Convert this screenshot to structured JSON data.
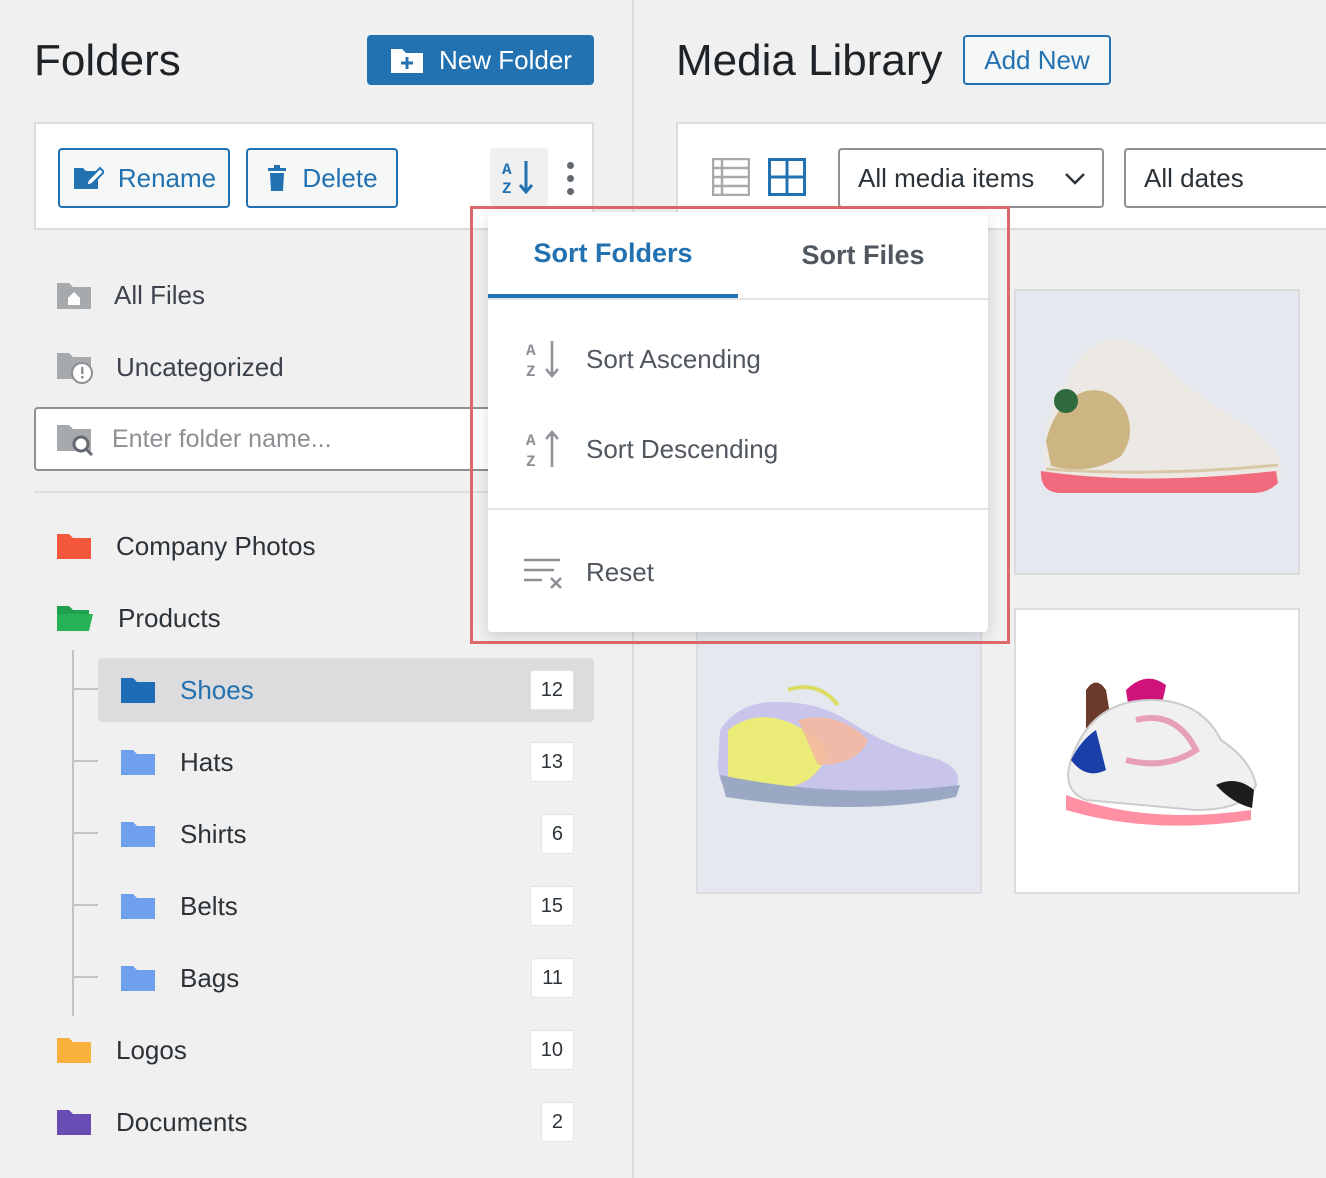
{
  "folders_panel": {
    "title": "Folders",
    "new_folder_label": "New Folder",
    "rename_label": "Rename",
    "delete_label": "Delete",
    "all_files_label": "All Files",
    "uncategorized_label": "Uncategorized",
    "search_placeholder": "Enter folder name...",
    "folders": [
      {
        "name": "Company Photos",
        "color": "#f4573b",
        "count": ""
      },
      {
        "name": "Products",
        "color": "#1fa04a",
        "count": ""
      },
      {
        "name": "Shoes",
        "color": "#1e6cb5",
        "count": "12",
        "selected": true
      },
      {
        "name": "Hats",
        "color": "#6fa0ee",
        "count": "13"
      },
      {
        "name": "Shirts",
        "color": "#6fa0ee",
        "count": "6"
      },
      {
        "name": "Belts",
        "color": "#6fa0ee",
        "count": "15"
      },
      {
        "name": "Bags",
        "color": "#6fa0ee",
        "count": "11"
      },
      {
        "name": "Logos",
        "color": "#f8b13c",
        "count": "10"
      },
      {
        "name": "Documents",
        "color": "#6a4cb5",
        "count": "2"
      }
    ]
  },
  "media_library": {
    "title": "Media Library",
    "add_new_label": "Add New",
    "filter_type": "All media items",
    "filter_date": "All dates"
  },
  "sort_menu": {
    "tab_folders": "Sort Folders",
    "tab_files": "Sort Files",
    "ascending": "Sort Ascending",
    "descending": "Sort Descending",
    "reset": "Reset"
  },
  "colors": {
    "accent": "#2271b1",
    "highlight": "#e06767"
  }
}
